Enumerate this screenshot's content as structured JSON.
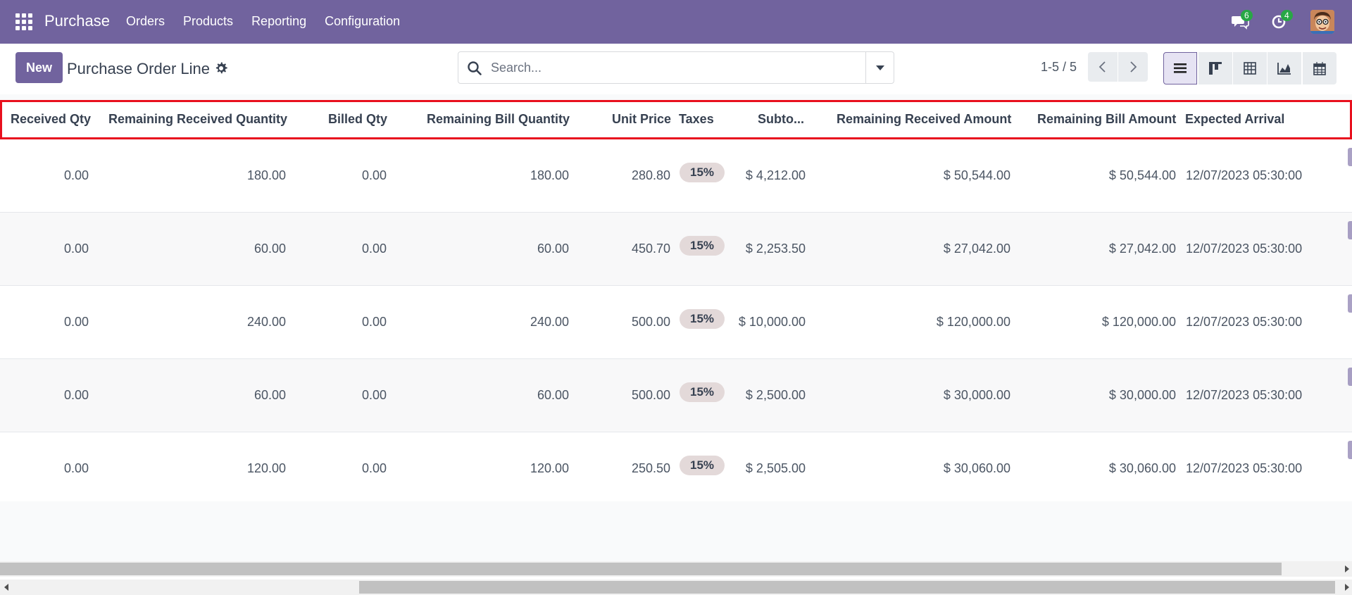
{
  "navbar": {
    "brand": "Purchase",
    "menu": [
      "Orders",
      "Products",
      "Reporting",
      "Configuration"
    ],
    "messages_count": "6",
    "activities_count": "4"
  },
  "control": {
    "new_label": "New",
    "title": "Purchase Order Line",
    "search_placeholder": "Search...",
    "pager": "1-5 / 5"
  },
  "table": {
    "headers": {
      "received_qty": "Received Qty",
      "remaining_received_quantity": "Remaining Received Quantity",
      "billed_qty": "Billed Qty",
      "remaining_bill_quantity": "Remaining Bill Quantity",
      "unit_price": "Unit Price",
      "taxes": "Taxes",
      "subtotal": "Subto...",
      "remaining_received_amount": "Remaining Received Amount",
      "remaining_bill_amount": "Remaining Bill Amount",
      "expected_arrival": "Expected Arrival"
    },
    "rows": [
      {
        "received_qty": "0.00",
        "remaining_received_quantity": "180.00",
        "billed_qty": "0.00",
        "remaining_bill_quantity": "180.00",
        "unit_price": "280.80",
        "taxes": "15%",
        "subtotal": "$ 4,212.00",
        "remaining_received_amount": "$ 50,544.00",
        "remaining_bill_amount": "$ 50,544.00",
        "expected_arrival": "12/07/2023 05:30:00"
      },
      {
        "received_qty": "0.00",
        "remaining_received_quantity": "60.00",
        "billed_qty": "0.00",
        "remaining_bill_quantity": "60.00",
        "unit_price": "450.70",
        "taxes": "15%",
        "subtotal": "$ 2,253.50",
        "remaining_received_amount": "$ 27,042.00",
        "remaining_bill_amount": "$ 27,042.00",
        "expected_arrival": "12/07/2023 05:30:00"
      },
      {
        "received_qty": "0.00",
        "remaining_received_quantity": "240.00",
        "billed_qty": "0.00",
        "remaining_bill_quantity": "240.00",
        "unit_price": "500.00",
        "taxes": "15%",
        "subtotal": "$ 10,000.00",
        "remaining_received_amount": "$ 120,000.00",
        "remaining_bill_amount": "$ 120,000.00",
        "expected_arrival": "12/07/2023 05:30:00"
      },
      {
        "received_qty": "0.00",
        "remaining_received_quantity": "60.00",
        "billed_qty": "0.00",
        "remaining_bill_quantity": "60.00",
        "unit_price": "500.00",
        "taxes": "15%",
        "subtotal": "$ 2,500.00",
        "remaining_received_amount": "$ 30,000.00",
        "remaining_bill_amount": "$ 30,000.00",
        "expected_arrival": "12/07/2023 05:30:00"
      },
      {
        "received_qty": "0.00",
        "remaining_received_quantity": "120.00",
        "billed_qty": "0.00",
        "remaining_bill_quantity": "120.00",
        "unit_price": "250.50",
        "taxes": "15%",
        "subtotal": "$ 2,505.00",
        "remaining_received_amount": "$ 30,060.00",
        "remaining_bill_amount": "$ 30,060.00",
        "expected_arrival": "12/07/2023 05:30:00"
      }
    ]
  },
  "colors": {
    "brand": "#71639e",
    "highlight_border": "#e8101e",
    "badge": "#28a745"
  },
  "icons": [
    "apps-icon",
    "chat-icon",
    "clock-icon",
    "avatar",
    "gear-icon",
    "search-icon",
    "chevron-down-icon",
    "chevron-left-icon",
    "chevron-right-icon",
    "list-view-icon",
    "kanban-view-icon",
    "pivot-view-icon",
    "graph-view-icon",
    "calendar-view-icon"
  ]
}
